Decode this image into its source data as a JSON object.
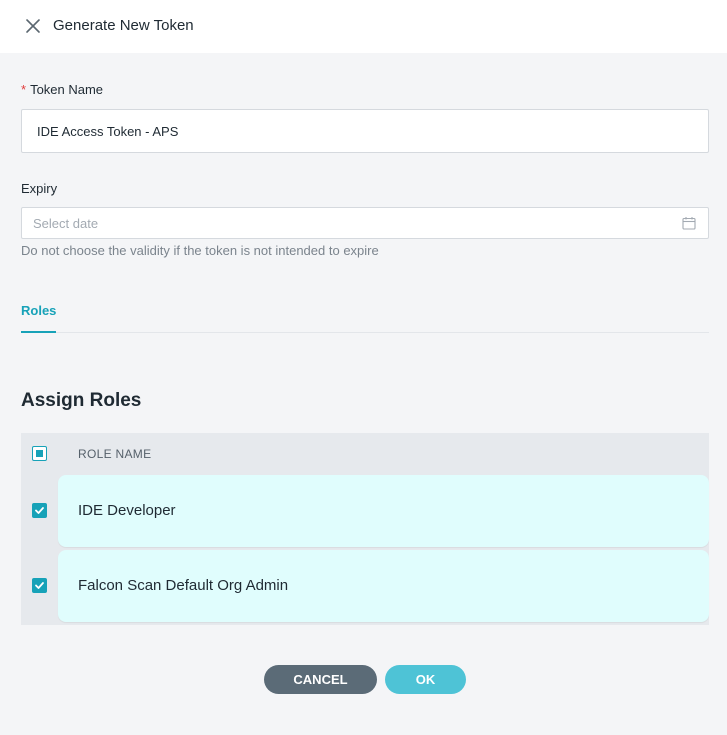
{
  "header": {
    "title": "Generate New Token",
    "close_icon": "close-icon"
  },
  "form": {
    "token_name": {
      "required_mark": "*",
      "label": "Token Name",
      "value": "IDE Access Token - APS"
    },
    "expiry": {
      "label": "Expiry",
      "placeholder": "Select date",
      "hint": "Do not choose the validity if the token is not intended to expire",
      "icon": "calendar-icon"
    }
  },
  "tabs": [
    {
      "label": "Roles",
      "active": true
    }
  ],
  "assign_roles": {
    "title": "Assign Roles",
    "column_header": "ROLE NAME",
    "select_all_state": "indeterminate",
    "rows": [
      {
        "name": "IDE Developer",
        "checked": true
      },
      {
        "name": "Falcon Scan Default Org Admin",
        "checked": true
      }
    ]
  },
  "actions": {
    "cancel_label": "CANCEL",
    "ok_label": "OK"
  },
  "colors": {
    "accent": "#17a2b8",
    "ok_button": "#4ec3d6",
    "cancel_button": "#5b6b77",
    "row_bg": "#e0fdfd"
  }
}
